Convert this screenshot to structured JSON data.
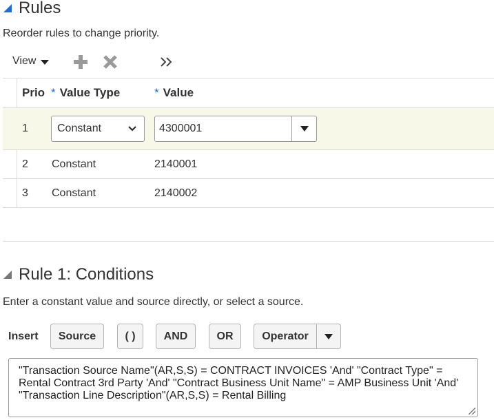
{
  "rules_section": {
    "title": "Rules",
    "instruction": "Reorder rules to change priority.",
    "toolbar": {
      "view_label": "View",
      "add_icon": "plus-icon",
      "delete_icon": "x-icon",
      "overflow_icon": "double-chevron-right-icon"
    },
    "table": {
      "headers": {
        "priority": "Prio",
        "value_type": "Value Type",
        "value": "Value",
        "required_marker": "*"
      },
      "rows": [
        {
          "priority": "1",
          "value_type": "Constant",
          "value": "4300001",
          "selected": true
        },
        {
          "priority": "2",
          "value_type": "Constant",
          "value": "2140001",
          "selected": false
        },
        {
          "priority": "3",
          "value_type": "Constant",
          "value": "2140002",
          "selected": false
        }
      ]
    }
  },
  "conditions_section": {
    "title": "Rule 1: Conditions",
    "instruction": "Enter a constant value and source directly, or select a source.",
    "insert_label": "Insert",
    "buttons": {
      "source": "Source",
      "parens": "( )",
      "and": "AND",
      "or": "OR",
      "operator": "Operator"
    },
    "expression": "\"Transaction Source Name\"(AR,S,S) = CONTRACT INVOICES 'And' \"Contract Type\" = Rental Contract 3rd Party 'And' \"Contract Business Unit Name\" = AMP Business Unit 'And' \"Transaction Line Description\"(AR,S,S) = Rental Billing"
  },
  "colors": {
    "accent_blue": "#1e6fcf",
    "selected_row": "#f7f8e8",
    "border": "#dcdcdc"
  }
}
